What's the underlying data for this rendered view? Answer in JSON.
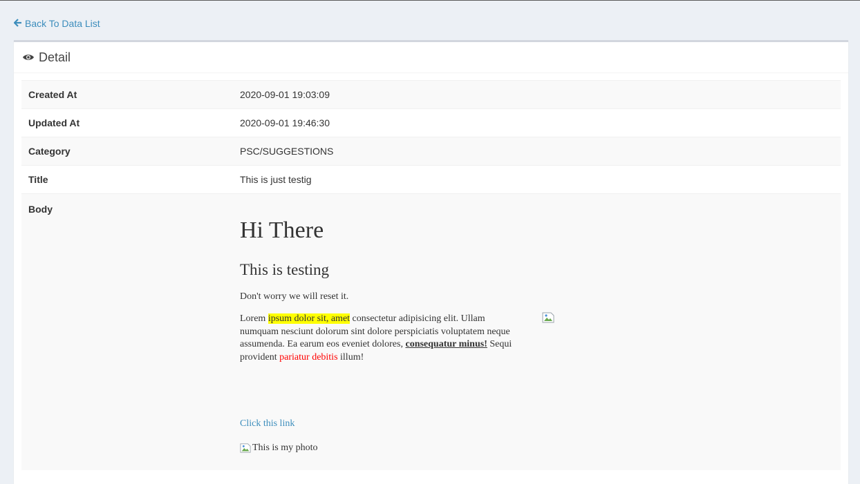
{
  "nav": {
    "back_label": "Back To Data List"
  },
  "box": {
    "title": "Detail"
  },
  "details": [
    {
      "label": "Created At",
      "value": "2020-09-01 19:03:09"
    },
    {
      "label": "Updated At",
      "value": "2020-09-01 19:46:30"
    },
    {
      "label": "Category",
      "value": "PSC/SUGGESTIONS"
    },
    {
      "label": "Title",
      "value": "This is just testig"
    },
    {
      "label": "Body"
    }
  ],
  "body": {
    "heading1": "Hi There",
    "heading2": "This is testing",
    "para1": "Don't worry we will reset it.",
    "para2": {
      "t1": "Lorem ",
      "highlight": "ipsum dolor sit, amet",
      "t2": " consectetur adipisicing elit. Ullam numquam nesciunt dolorum sint dolore perspiciatis voluptatem neque assumenda. Ea earum eos eveniet dolores, ",
      "bold_underline": "consequatur minus!",
      "t3": " Sequi provident ",
      "red": "pariatur debitis",
      "t4": " illum!"
    },
    "link_label": "Click this link",
    "photo_alt": "This is my photo"
  },
  "colors": {
    "link": "#3c8dbc",
    "highlight": "#ffff00",
    "red_text": "#ff0000",
    "background": "#ecf0f5"
  },
  "icons": {
    "back": "arrow-left-icon",
    "detail": "eye-icon",
    "broken_image": "broken-image-icon"
  }
}
